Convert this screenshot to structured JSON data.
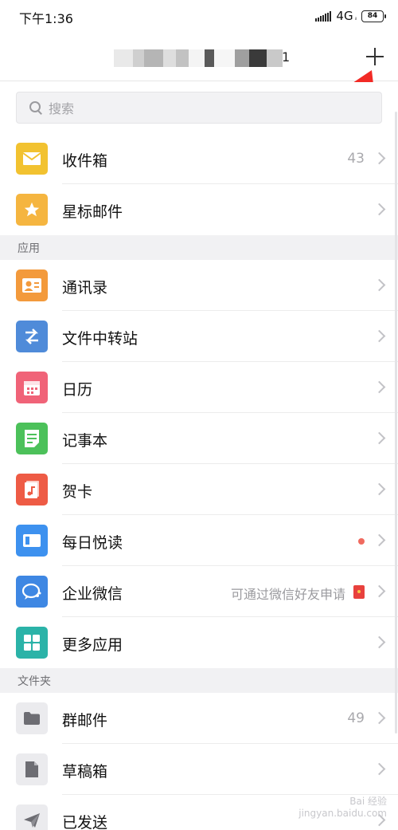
{
  "status_bar": {
    "time": "下午1:36",
    "network": "4G",
    "network_sub": "ᵢₗ",
    "battery": "84"
  },
  "header": {
    "title_suffix": "1",
    "plus_icon": "plus-icon"
  },
  "search": {
    "placeholder": "搜索"
  },
  "mailboxes": [
    {
      "label": "收件箱",
      "count": "43",
      "icon": "inbox-icon",
      "color": "#f2c230"
    },
    {
      "label": "星标邮件",
      "icon": "star-icon",
      "color": "#f5b540"
    }
  ],
  "sections": {
    "apps": "应用",
    "folders": "文件夹"
  },
  "apps": [
    {
      "label": "通讯录",
      "icon": "contacts-icon",
      "color": "#f39a3c"
    },
    {
      "label": "文件中转站",
      "icon": "transfer-icon",
      "color": "#4f8bd9"
    },
    {
      "label": "日历",
      "icon": "calendar-icon",
      "color": "#f06378"
    },
    {
      "label": "记事本",
      "icon": "notes-icon",
      "color": "#4cc15a"
    },
    {
      "label": "贺卡",
      "icon": "greeting-card-icon",
      "color": "#ee5b45"
    },
    {
      "label": "每日悦读",
      "icon": "reading-icon",
      "color": "#3d91ef"
    },
    {
      "label": "企业微信",
      "hint": "可通过微信好友申请",
      "icon": "wework-icon",
      "color": "#3e87e3"
    },
    {
      "label": "更多应用",
      "icon": "more-apps-icon",
      "color": "#2bb3a8"
    }
  ],
  "folders": [
    {
      "label": "群邮件",
      "count": "49",
      "icon": "folder-icon"
    },
    {
      "label": "草稿箱",
      "icon": "draft-icon"
    },
    {
      "label": "已发送",
      "icon": "sent-icon"
    }
  ],
  "watermark": {
    "line1": "Bai 经验",
    "line2": "jingyan.baidu.com"
  }
}
